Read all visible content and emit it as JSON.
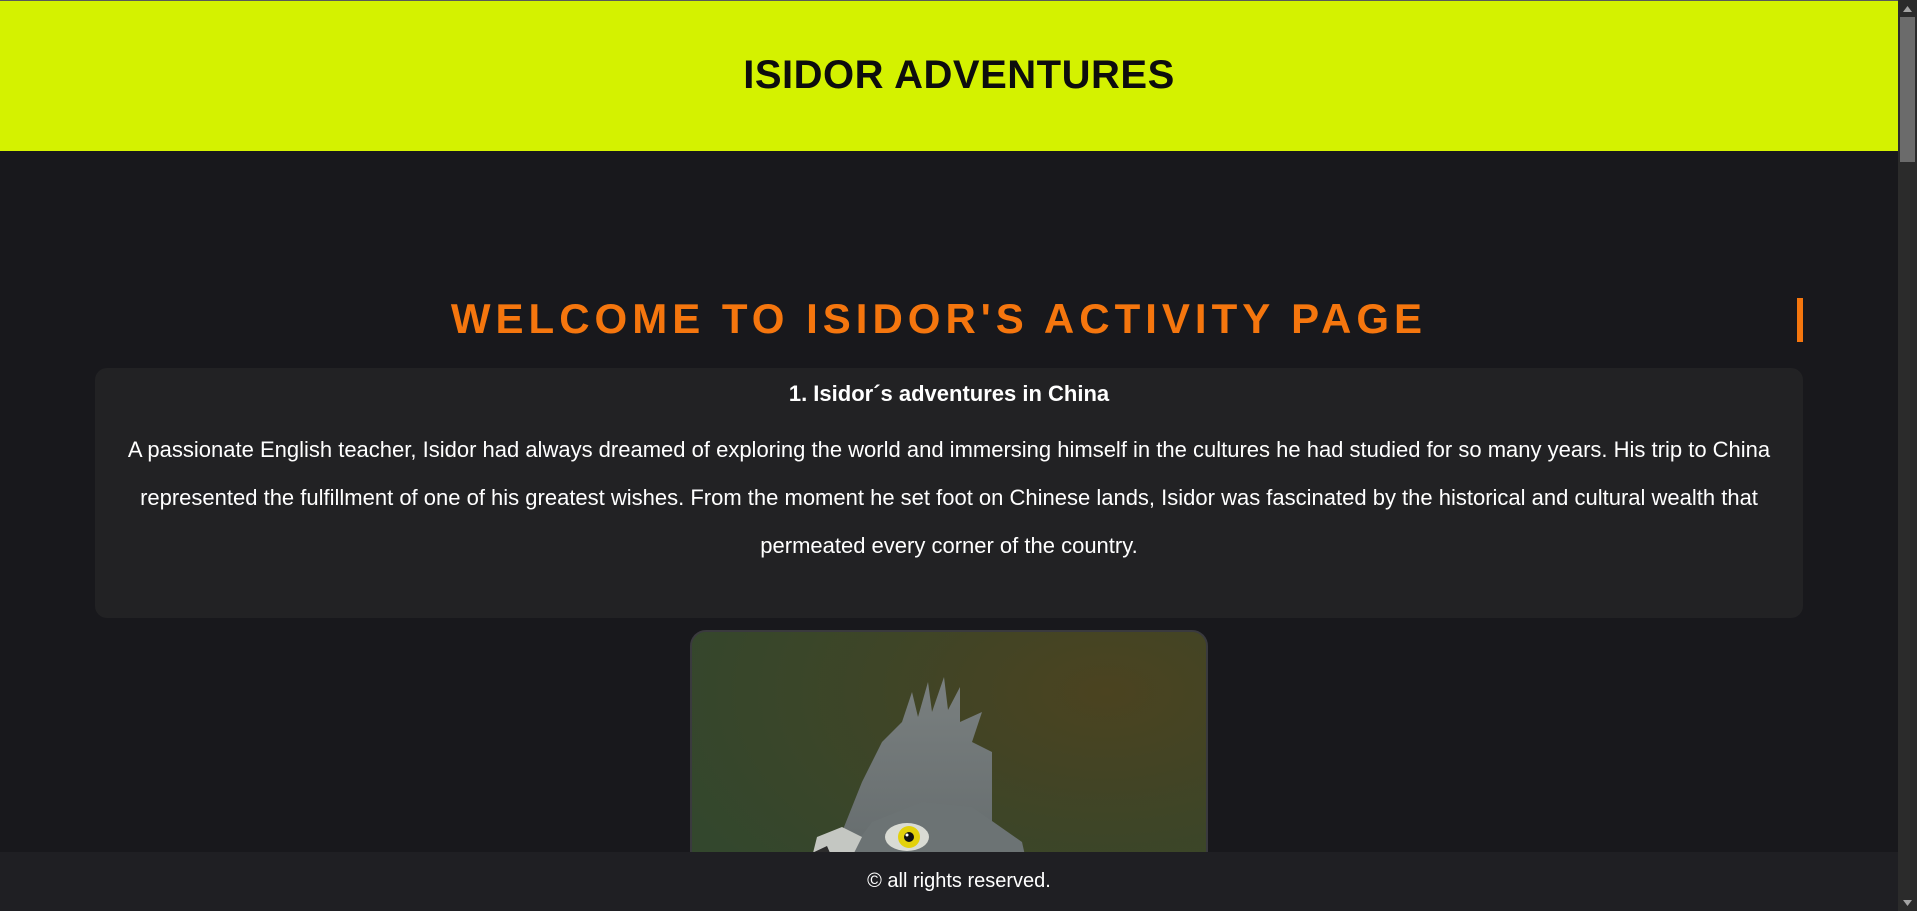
{
  "header": {
    "title": "ISIDOR ADVENTURES"
  },
  "main": {
    "heading": "WELCOME TO ISIDOR'S ACTIVITY PAGE",
    "activity": {
      "title": "1. Isidor´s adventures in China",
      "text": "A passionate English teacher, Isidor had always dreamed of exploring the world and immersing himself in the cultures he had studied for so many years. His trip to China represented the fulfillment of one of his greatest wishes. From the moment he set foot on Chinese lands, Isidor was fascinated by the historical and cultural wealth that permeated every corner of the country."
    },
    "photo": {
      "subject": "eagle-photo"
    }
  },
  "footer": {
    "text": "© all rights reserved."
  },
  "colors": {
    "header_bg": "#d4f200",
    "page_bg": "#18181c",
    "card_bg": "#222224",
    "accent": "#f5760e",
    "footer_bg": "#1f1f23"
  }
}
